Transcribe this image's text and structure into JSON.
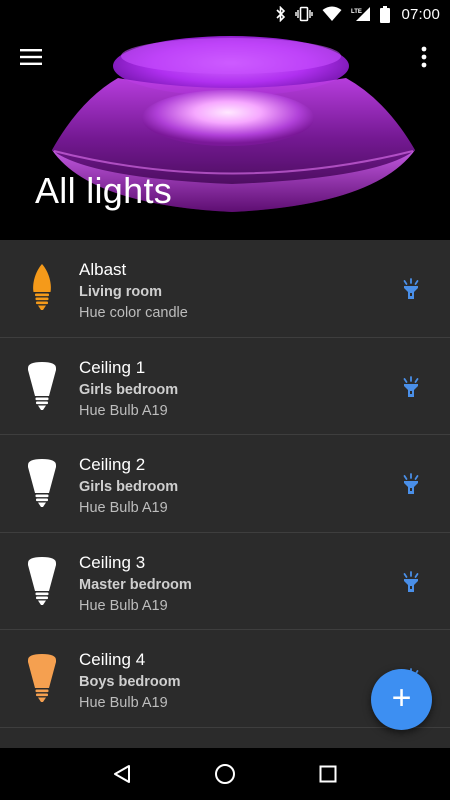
{
  "status_bar": {
    "time": "07:00",
    "icons": [
      "bluetooth-icon",
      "vibrate-icon",
      "wifi-icon",
      "lte-signal-icon",
      "battery-icon"
    ],
    "network_label": "LTE"
  },
  "header": {
    "title": "All lights",
    "menu_icon": "hamburger-menu-icon",
    "more_icon": "more-vert-icon"
  },
  "lights": [
    {
      "name": "Albast",
      "room": "Living room",
      "model": "Hue color candle",
      "bulb_type": "candle",
      "bulb_color": "#f59a1a"
    },
    {
      "name": "Ceiling 1",
      "room": "Girls bedroom",
      "model": "Hue Bulb A19",
      "bulb_type": "bulb",
      "bulb_color": "#ffffff"
    },
    {
      "name": "Ceiling 2",
      "room": "Girls bedroom",
      "model": "Hue Bulb A19",
      "bulb_type": "bulb",
      "bulb_color": "#ffffff"
    },
    {
      "name": "Ceiling 3",
      "room": "Master bedroom",
      "model": "Hue Bulb A19",
      "bulb_type": "bulb",
      "bulb_color": "#ffffff"
    },
    {
      "name": "Ceiling 4",
      "room": "Boys bedroom",
      "model": "Hue Bulb A19",
      "bulb_type": "bulb",
      "bulb_color": "#f5a050"
    }
  ],
  "toggle_icon": "flashlight-icon",
  "fab": {
    "label": "+",
    "icon": "add-icon"
  },
  "nav": [
    "back-icon",
    "home-icon",
    "recents-icon"
  ],
  "colors": {
    "accent": "#3d8ff2",
    "toggle": "#4a8fe8",
    "list_background": "#2b2b2b",
    "divider": "#3e3e3e"
  }
}
